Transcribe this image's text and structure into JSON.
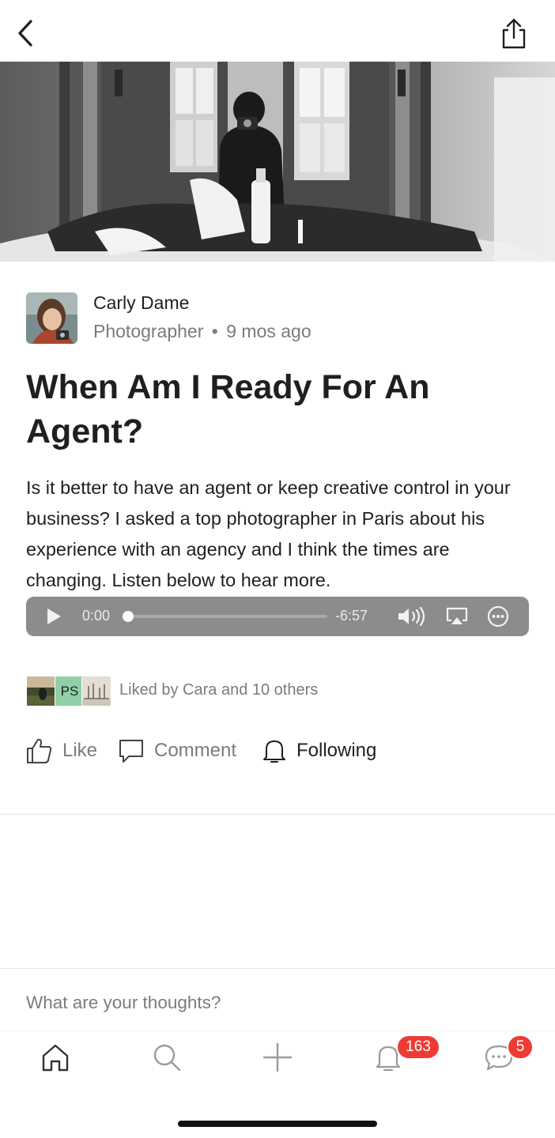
{
  "post": {
    "author": {
      "name": "Carly Dame",
      "role": "Photographer",
      "separator": "•",
      "posted_ago": "9 mos ago"
    },
    "title": "When Am I Ready For An Agent?",
    "body": "Is it better to have an agent or keep creative control in your business? I asked a top photographer in Paris about his experience with an agency and I think the times are changing. Listen below to hear more."
  },
  "audio_player": {
    "elapsed": "0:00",
    "remaining": "-6:57",
    "progress": 0
  },
  "likes": {
    "text": "Liked by Cara and 10 others",
    "avatar_initials": "PS"
  },
  "actions": {
    "like_label": "Like",
    "comment_label": "Comment",
    "following_label": "Following"
  },
  "comment_box": {
    "placeholder": "What are your thoughts?"
  },
  "tab_bar": {
    "notifications_badge": "163",
    "messages_badge": "5"
  },
  "icons": [
    "back-icon",
    "share-icon",
    "play-icon",
    "volume-icon",
    "airplay-icon",
    "more-icon",
    "like-icon",
    "comment-icon",
    "bell-icon",
    "home-icon",
    "search-icon",
    "plus-icon",
    "chat-icon"
  ],
  "colors": {
    "badge": "#ef3b36",
    "muted_text": "#7b7b7b",
    "player_bg": "#8c8c8c"
  }
}
